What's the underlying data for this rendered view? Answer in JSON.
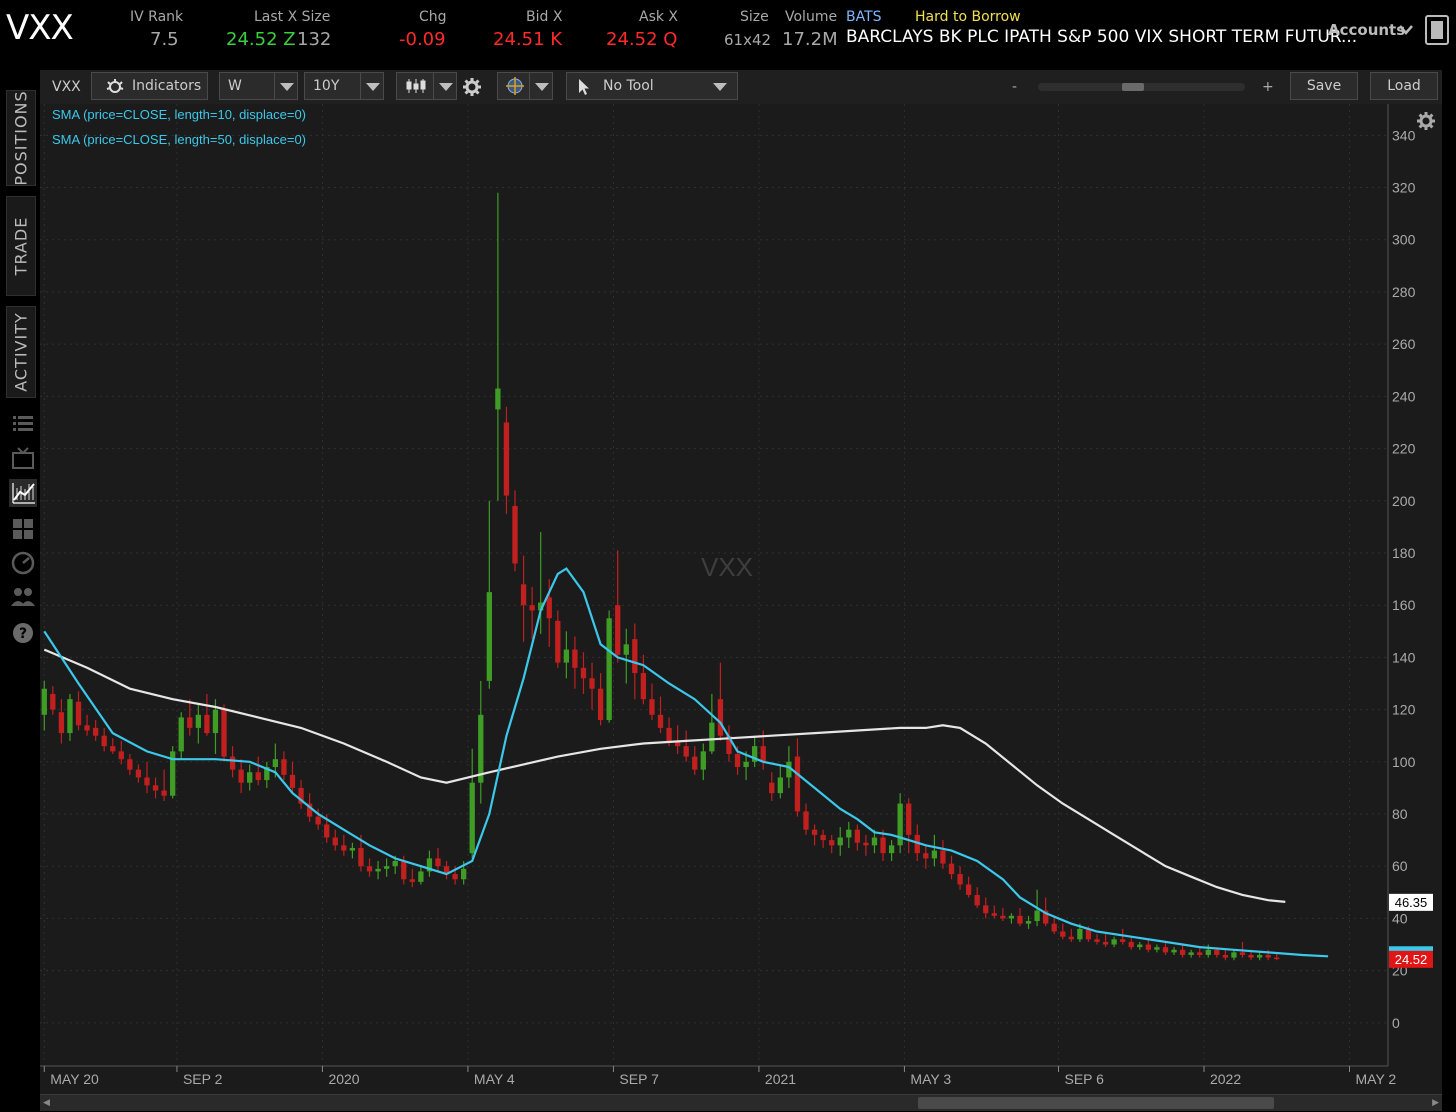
{
  "header": {
    "symbol": "VXX",
    "iv_rank_label": "IV Rank",
    "iv_rank": "7.5",
    "last_label": "Last X Size",
    "last_price": "24.52 Z",
    "last_size": "132",
    "chg_label": "Chg",
    "chg": "-0.09",
    "bid_label": "Bid X",
    "bid": "24.51 K",
    "ask_label": "Ask X",
    "ask": "24.52 Q",
    "size_label": "Size",
    "size": "61x42",
    "volume_label": "Volume",
    "volume": "17.2M",
    "exchange": "BATS",
    "htb": "Hard to Borrow",
    "description": "BARCLAYS BK PLC IPATH S&P 500 VIX SHORT TERM FUTUR...",
    "accounts": "Accounts"
  },
  "toolbar": {
    "symbol": "VXX",
    "indicators": "Indicators",
    "aggregation": "W",
    "timeframe": "10Y",
    "tool": "No Tool",
    "zoom_minus": "-",
    "zoom_plus": "+",
    "save": "Save",
    "load": "Load"
  },
  "sidebar": {
    "tabs": [
      "POSITIONS",
      "TRADE",
      "ACTIVITY"
    ]
  },
  "colors": {
    "up": "#3f9c25",
    "down": "#c21f1f",
    "sma10": "#3cc8ea",
    "sma50": "#e6e6e6",
    "grid": "#303030",
    "bg": "#1b1b1b",
    "positive": "#3ccf3c",
    "negative": "#ff2a2a",
    "htb": "#f0e050",
    "exchange": "#7fb6ff"
  },
  "chart_data": {
    "type": "candlestick",
    "watermark": "VXX",
    "studies": [
      "SMA (price=CLOSE, length=10, displace=0)",
      "SMA (price=CLOSE, length=50, displace=0)"
    ],
    "x_ticks": [
      "MAY 20",
      "SEP 2",
      "2020",
      "MAY 4",
      "SEP 7",
      "2021",
      "MAY 3",
      "SEP 6",
      "2022",
      "MAY 2"
    ],
    "y_ticks": [
      0,
      20,
      40,
      60,
      80,
      100,
      120,
      140,
      160,
      180,
      200,
      220,
      240,
      260,
      280,
      300,
      320,
      340
    ],
    "y_range": [
      -15,
      352
    ],
    "x_range_weeks": [
      -0.5,
      157
    ],
    "price_tags": [
      {
        "label": "46.35",
        "value": 46.35,
        "series": "sma50"
      },
      {
        "label": "24.52",
        "value": 24.52,
        "series": "last"
      }
    ],
    "candles": [
      {
        "o": 118,
        "h": 131,
        "l": 112,
        "c": 128
      },
      {
        "o": 126,
        "h": 129,
        "l": 118,
        "c": 120
      },
      {
        "o": 119,
        "h": 124,
        "l": 107,
        "c": 111
      },
      {
        "o": 111,
        "h": 126,
        "l": 108,
        "c": 124
      },
      {
        "o": 123,
        "h": 127,
        "l": 112,
        "c": 114
      },
      {
        "o": 114,
        "h": 118,
        "l": 110,
        "c": 112
      },
      {
        "o": 113,
        "h": 116,
        "l": 108,
        "c": 110
      },
      {
        "o": 110,
        "h": 113,
        "l": 104,
        "c": 106
      },
      {
        "o": 106,
        "h": 109,
        "l": 103,
        "c": 104
      },
      {
        "o": 104,
        "h": 108,
        "l": 99,
        "c": 101
      },
      {
        "o": 101,
        "h": 103,
        "l": 95,
        "c": 97
      },
      {
        "o": 97,
        "h": 99,
        "l": 92,
        "c": 94
      },
      {
        "o": 94,
        "h": 100,
        "l": 88,
        "c": 91
      },
      {
        "o": 91,
        "h": 94,
        "l": 86,
        "c": 89
      },
      {
        "o": 89,
        "h": 97,
        "l": 85,
        "c": 87
      },
      {
        "o": 87,
        "h": 106,
        "l": 86,
        "c": 104
      },
      {
        "o": 104,
        "h": 119,
        "l": 101,
        "c": 117
      },
      {
        "o": 117,
        "h": 124,
        "l": 110,
        "c": 113
      },
      {
        "o": 113,
        "h": 122,
        "l": 107,
        "c": 118
      },
      {
        "o": 118,
        "h": 126,
        "l": 110,
        "c": 111
      },
      {
        "o": 111,
        "h": 124,
        "l": 103,
        "c": 120
      },
      {
        "o": 120,
        "h": 122,
        "l": 100,
        "c": 102
      },
      {
        "o": 102,
        "h": 106,
        "l": 94,
        "c": 97
      },
      {
        "o": 97,
        "h": 101,
        "l": 88,
        "c": 92
      },
      {
        "o": 92,
        "h": 99,
        "l": 89,
        "c": 96
      },
      {
        "o": 96,
        "h": 102,
        "l": 91,
        "c": 93
      },
      {
        "o": 93,
        "h": 100,
        "l": 90,
        "c": 98
      },
      {
        "o": 98,
        "h": 107,
        "l": 94,
        "c": 101
      },
      {
        "o": 101,
        "h": 104,
        "l": 93,
        "c": 95
      },
      {
        "o": 95,
        "h": 100,
        "l": 88,
        "c": 90
      },
      {
        "o": 90,
        "h": 93,
        "l": 82,
        "c": 84
      },
      {
        "o": 84,
        "h": 88,
        "l": 77,
        "c": 79
      },
      {
        "o": 79,
        "h": 82,
        "l": 74,
        "c": 76
      },
      {
        "o": 76,
        "h": 80,
        "l": 69,
        "c": 71
      },
      {
        "o": 71,
        "h": 74,
        "l": 66,
        "c": 68
      },
      {
        "o": 68,
        "h": 72,
        "l": 64,
        "c": 66
      },
      {
        "o": 66,
        "h": 69,
        "l": 63,
        "c": 67
      },
      {
        "o": 67,
        "h": 72,
        "l": 58,
        "c": 60
      },
      {
        "o": 60,
        "h": 63,
        "l": 56,
        "c": 58
      },
      {
        "o": 58,
        "h": 62,
        "l": 55,
        "c": 59
      },
      {
        "o": 59,
        "h": 63,
        "l": 56,
        "c": 60
      },
      {
        "o": 60,
        "h": 64,
        "l": 57,
        "c": 62
      },
      {
        "o": 62,
        "h": 64,
        "l": 53,
        "c": 55
      },
      {
        "o": 55,
        "h": 59,
        "l": 52,
        "c": 54
      },
      {
        "o": 54,
        "h": 60,
        "l": 53,
        "c": 58
      },
      {
        "o": 58,
        "h": 66,
        "l": 56,
        "c": 63
      },
      {
        "o": 63,
        "h": 67,
        "l": 58,
        "c": 60
      },
      {
        "o": 60,
        "h": 62,
        "l": 55,
        "c": 57
      },
      {
        "o": 57,
        "h": 60,
        "l": 53,
        "c": 55
      },
      {
        "o": 55,
        "h": 62,
        "l": 53,
        "c": 59
      },
      {
        "o": 65,
        "h": 105,
        "l": 63,
        "c": 92
      },
      {
        "o": 92,
        "h": 131,
        "l": 84,
        "c": 118
      },
      {
        "o": 131,
        "h": 200,
        "l": 128,
        "c": 165
      },
      {
        "o": 235,
        "h": 318,
        "l": 200,
        "c": 243
      },
      {
        "o": 230,
        "h": 236,
        "l": 195,
        "c": 202
      },
      {
        "o": 198,
        "h": 204,
        "l": 173,
        "c": 176
      },
      {
        "o": 168,
        "h": 179,
        "l": 146,
        "c": 160
      },
      {
        "o": 160,
        "h": 167,
        "l": 147,
        "c": 158
      },
      {
        "o": 158,
        "h": 188,
        "l": 149,
        "c": 161
      },
      {
        "o": 163,
        "h": 170,
        "l": 144,
        "c": 155
      },
      {
        "o": 154,
        "h": 158,
        "l": 136,
        "c": 138
      },
      {
        "o": 138,
        "h": 150,
        "l": 132,
        "c": 143
      },
      {
        "o": 143,
        "h": 148,
        "l": 128,
        "c": 136
      },
      {
        "o": 136,
        "h": 142,
        "l": 126,
        "c": 132
      },
      {
        "o": 132,
        "h": 138,
        "l": 120,
        "c": 128
      },
      {
        "o": 128,
        "h": 134,
        "l": 114,
        "c": 116
      },
      {
        "o": 116,
        "h": 158,
        "l": 115,
        "c": 155
      },
      {
        "o": 160,
        "h": 181,
        "l": 138,
        "c": 141
      },
      {
        "o": 141,
        "h": 151,
        "l": 130,
        "c": 145
      },
      {
        "o": 147,
        "h": 153,
        "l": 124,
        "c": 134
      },
      {
        "o": 134,
        "h": 141,
        "l": 122,
        "c": 124
      },
      {
        "o": 124,
        "h": 130,
        "l": 116,
        "c": 118
      },
      {
        "o": 118,
        "h": 125,
        "l": 111,
        "c": 113
      },
      {
        "o": 113,
        "h": 117,
        "l": 106,
        "c": 108
      },
      {
        "o": 108,
        "h": 114,
        "l": 103,
        "c": 106
      },
      {
        "o": 106,
        "h": 112,
        "l": 100,
        "c": 102
      },
      {
        "o": 102,
        "h": 106,
        "l": 95,
        "c": 97
      },
      {
        "o": 97,
        "h": 107,
        "l": 93,
        "c": 104
      },
      {
        "o": 104,
        "h": 126,
        "l": 103,
        "c": 115
      },
      {
        "o": 124,
        "h": 138,
        "l": 108,
        "c": 110
      },
      {
        "o": 110,
        "h": 114,
        "l": 100,
        "c": 103
      },
      {
        "o": 103,
        "h": 106,
        "l": 95,
        "c": 98
      },
      {
        "o": 98,
        "h": 104,
        "l": 93,
        "c": 100
      },
      {
        "o": 100,
        "h": 110,
        "l": 98,
        "c": 106
      },
      {
        "o": 106,
        "h": 112,
        "l": 97,
        "c": 100
      },
      {
        "o": 92,
        "h": 96,
        "l": 85,
        "c": 88
      },
      {
        "o": 88,
        "h": 99,
        "l": 86,
        "c": 94
      },
      {
        "o": 94,
        "h": 106,
        "l": 90,
        "c": 100
      },
      {
        "o": 102,
        "h": 109,
        "l": 79,
        "c": 81
      },
      {
        "o": 81,
        "h": 84,
        "l": 72,
        "c": 74
      },
      {
        "o": 74,
        "h": 76,
        "l": 68,
        "c": 72
      },
      {
        "o": 72,
        "h": 74,
        "l": 67,
        "c": 70
      },
      {
        "o": 70,
        "h": 72,
        "l": 65,
        "c": 68
      },
      {
        "o": 68,
        "h": 75,
        "l": 64,
        "c": 71
      },
      {
        "o": 71,
        "h": 77,
        "l": 67,
        "c": 74
      },
      {
        "o": 74,
        "h": 76,
        "l": 66,
        "c": 69
      },
      {
        "o": 69,
        "h": 72,
        "l": 64,
        "c": 68
      },
      {
        "o": 68,
        "h": 74,
        "l": 65,
        "c": 71
      },
      {
        "o": 71,
        "h": 74,
        "l": 62,
        "c": 65
      },
      {
        "o": 65,
        "h": 70,
        "l": 62,
        "c": 68
      },
      {
        "o": 68,
        "h": 88,
        "l": 65,
        "c": 84
      },
      {
        "o": 84,
        "h": 86,
        "l": 65,
        "c": 72
      },
      {
        "o": 72,
        "h": 76,
        "l": 62,
        "c": 65
      },
      {
        "o": 65,
        "h": 68,
        "l": 59,
        "c": 63
      },
      {
        "o": 63,
        "h": 72,
        "l": 60,
        "c": 66
      },
      {
        "o": 66,
        "h": 70,
        "l": 59,
        "c": 61
      },
      {
        "o": 61,
        "h": 64,
        "l": 55,
        "c": 57
      },
      {
        "o": 57,
        "h": 60,
        "l": 51,
        "c": 53
      },
      {
        "o": 53,
        "h": 56,
        "l": 48,
        "c": 49
      },
      {
        "o": 49,
        "h": 52,
        "l": 44,
        "c": 45
      },
      {
        "o": 45,
        "h": 48,
        "l": 40,
        "c": 42
      },
      {
        "o": 42,
        "h": 45,
        "l": 40,
        "c": 41
      },
      {
        "o": 41,
        "h": 44,
        "l": 39,
        "c": 40
      },
      {
        "o": 40,
        "h": 42,
        "l": 38,
        "c": 41
      },
      {
        "o": 41,
        "h": 44,
        "l": 37,
        "c": 38
      },
      {
        "o": 38,
        "h": 41,
        "l": 36,
        "c": 39
      },
      {
        "o": 39,
        "h": 51,
        "l": 37,
        "c": 43
      },
      {
        "o": 43,
        "h": 48,
        "l": 37,
        "c": 38
      },
      {
        "o": 38,
        "h": 41,
        "l": 34,
        "c": 35
      },
      {
        "o": 35,
        "h": 38,
        "l": 32,
        "c": 33
      },
      {
        "o": 33,
        "h": 36,
        "l": 31,
        "c": 32
      },
      {
        "o": 32,
        "h": 38,
        "l": 31,
        "c": 36
      },
      {
        "o": 36,
        "h": 37,
        "l": 31,
        "c": 32
      },
      {
        "o": 32,
        "h": 34,
        "l": 30,
        "c": 31
      },
      {
        "o": 31,
        "h": 34,
        "l": 29,
        "c": 30
      },
      {
        "o": 30,
        "h": 33,
        "l": 29,
        "c": 32
      },
      {
        "o": 32,
        "h": 36,
        "l": 30,
        "c": 31
      },
      {
        "o": 31,
        "h": 33,
        "l": 28,
        "c": 29
      },
      {
        "o": 29,
        "h": 31,
        "l": 28,
        "c": 30
      },
      {
        "o": 30,
        "h": 32,
        "l": 27,
        "c": 28
      },
      {
        "o": 28,
        "h": 30,
        "l": 27,
        "c": 29
      },
      {
        "o": 29,
        "h": 31,
        "l": 26,
        "c": 27
      },
      {
        "o": 27,
        "h": 29,
        "l": 26,
        "c": 28
      },
      {
        "o": 28,
        "h": 30,
        "l": 25,
        "c": 26
      },
      {
        "o": 26,
        "h": 28,
        "l": 25,
        "c": 27
      },
      {
        "o": 27,
        "h": 29,
        "l": 25,
        "c": 26
      },
      {
        "o": 26,
        "h": 30,
        "l": 25,
        "c": 28
      },
      {
        "o": 28,
        "h": 29,
        "l": 25,
        "c": 26
      },
      {
        "o": 26,
        "h": 28,
        "l": 24,
        "c": 25
      },
      {
        "o": 25,
        "h": 28,
        "l": 24,
        "c": 27
      },
      {
        "o": 27,
        "h": 31,
        "l": 25,
        "c": 26
      },
      {
        "o": 26,
        "h": 28,
        "l": 24,
        "c": 25
      },
      {
        "o": 25,
        "h": 27,
        "l": 24,
        "c": 26
      },
      {
        "o": 26,
        "h": 28,
        "l": 24,
        "c": 25
      },
      {
        "o": 25,
        "h": 27,
        "l": 24,
        "c": 24.52
      }
    ],
    "sma10_points": [
      [
        0,
        150
      ],
      [
        4,
        130
      ],
      [
        8,
        111
      ],
      [
        12,
        104
      ],
      [
        15,
        101
      ],
      [
        20,
        101
      ],
      [
        24,
        100
      ],
      [
        27,
        96
      ],
      [
        29,
        88
      ],
      [
        32,
        80
      ],
      [
        35,
        74
      ],
      [
        38,
        68
      ],
      [
        41,
        63
      ],
      [
        44,
        60
      ],
      [
        47,
        57
      ],
      [
        50,
        62
      ],
      [
        52,
        80
      ],
      [
        54,
        110
      ],
      [
        56,
        132
      ],
      [
        58,
        158
      ],
      [
        60,
        172
      ],
      [
        61,
        174
      ],
      [
        63,
        165
      ],
      [
        65,
        145
      ],
      [
        67,
        140
      ],
      [
        70,
        137
      ],
      [
        73,
        130
      ],
      [
        76,
        124
      ],
      [
        79,
        115
      ],
      [
        81,
        104
      ],
      [
        84,
        100
      ],
      [
        87,
        98
      ],
      [
        90,
        90
      ],
      [
        93,
        82
      ],
      [
        95,
        78
      ],
      [
        97,
        73
      ],
      [
        99,
        72
      ],
      [
        101,
        70
      ],
      [
        103,
        68
      ],
      [
        106,
        66
      ],
      [
        109,
        62
      ],
      [
        112,
        55
      ],
      [
        114,
        48
      ],
      [
        117,
        42
      ],
      [
        120,
        38
      ],
      [
        123,
        35
      ],
      [
        127,
        33
      ],
      [
        131,
        31
      ],
      [
        135,
        29
      ],
      [
        139,
        28
      ],
      [
        143,
        27
      ],
      [
        147,
        26
      ],
      [
        150,
        25.5
      ]
    ],
    "sma50_points": [
      [
        0,
        143
      ],
      [
        5,
        136
      ],
      [
        10,
        128
      ],
      [
        15,
        124
      ],
      [
        20,
        121
      ],
      [
        25,
        117
      ],
      [
        30,
        113
      ],
      [
        35,
        107
      ],
      [
        40,
        100
      ],
      [
        44,
        94
      ],
      [
        47,
        92
      ],
      [
        52,
        96
      ],
      [
        56,
        99
      ],
      [
        60,
        102
      ],
      [
        65,
        105
      ],
      [
        70,
        107
      ],
      [
        75,
        108
      ],
      [
        80,
        109
      ],
      [
        85,
        110
      ],
      [
        90,
        111
      ],
      [
        95,
        112
      ],
      [
        100,
        113
      ],
      [
        103,
        113
      ],
      [
        105,
        114
      ],
      [
        107,
        113
      ],
      [
        110,
        107
      ],
      [
        113,
        99
      ],
      [
        116,
        91
      ],
      [
        119,
        84
      ],
      [
        122,
        78
      ],
      [
        125,
        72
      ],
      [
        128,
        66
      ],
      [
        131,
        60
      ],
      [
        134,
        56
      ],
      [
        137,
        52
      ],
      [
        140,
        49
      ],
      [
        143,
        47
      ],
      [
        145,
        46.35
      ]
    ]
  }
}
